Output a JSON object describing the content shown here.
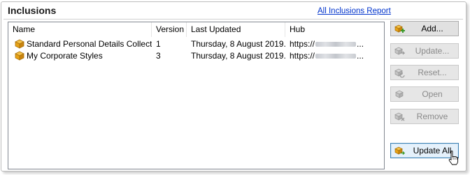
{
  "panel": {
    "title": "Inclusions",
    "report_link": "All Inclusions Report"
  },
  "table": {
    "columns": [
      "Name",
      "Version",
      "Last Updated",
      "Hub"
    ],
    "rows": [
      {
        "name": "Standard Personal Details Collection",
        "version": "1",
        "last_updated": "Thursday, 8 August 2019...",
        "hub_prefix": "https://",
        "hub_suffix": "..."
      },
      {
        "name": "My Corporate Styles",
        "version": "3",
        "last_updated": "Thursday, 8 August 2019...",
        "hub_prefix": "https://",
        "hub_suffix": "..."
      }
    ]
  },
  "buttons": {
    "add": {
      "label": "Add...",
      "enabled": true
    },
    "update": {
      "label": "Update...",
      "enabled": false
    },
    "reset": {
      "label": "Reset...",
      "enabled": false
    },
    "open": {
      "label": "Open",
      "enabled": false
    },
    "remove": {
      "label": "Remove",
      "enabled": false
    },
    "update_all": {
      "label": "Update All",
      "enabled": true
    }
  },
  "colors": {
    "link": "#0033cc",
    "package_icon": "#e8a317",
    "add_accent": "#3a9a2a"
  }
}
